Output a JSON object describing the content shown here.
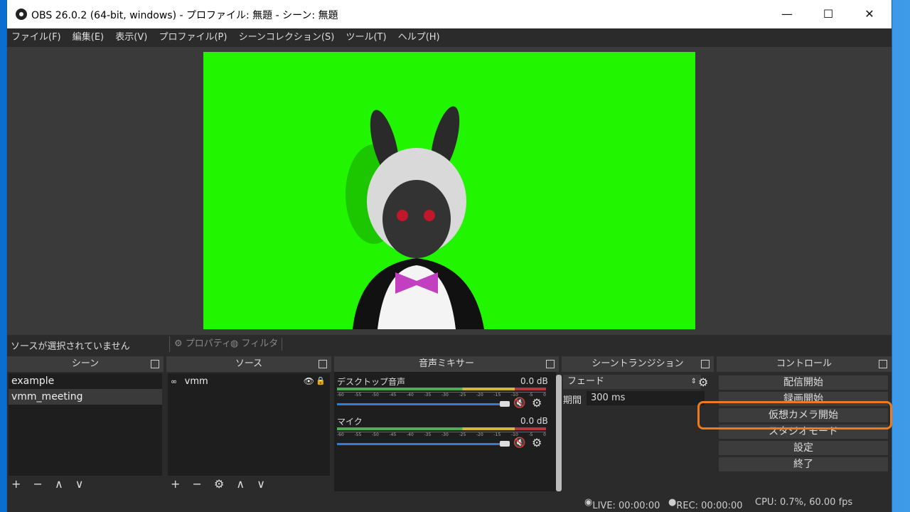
{
  "window": {
    "title": "OBS 26.0.2 (64-bit, windows) - プロファイル: 無題 - シーン: 無題",
    "minimize": "—",
    "maximize": "☐",
    "close": "✕"
  },
  "menu": [
    "ファイル(F)",
    "編集(E)",
    "表示(V)",
    "プロファイル(P)",
    "シーンコレクション(S)",
    "ツール(T)",
    "ヘルプ(H)"
  ],
  "source_bar": {
    "no_selection": "ソースが選択されていません",
    "properties": "プロパティ",
    "filters": "フィルタ"
  },
  "scenes": {
    "title": "シーン",
    "items": [
      "example",
      "vmm_meeting"
    ],
    "selected": 1,
    "tools": "+ − ∧ ∨"
  },
  "sources": {
    "title": "ソース",
    "items": [
      {
        "name": "vmm"
      }
    ],
    "tools": "+ − ⚙ ∧ ∨"
  },
  "mixer": {
    "title": "音声ミキサー",
    "channels": [
      {
        "name": "デスクトップ音声",
        "db": "0.0 dB"
      },
      {
        "name": "マイク",
        "db": "0.0 dB"
      }
    ],
    "ticks": [
      "-60",
      "-55",
      "-50",
      "-45",
      "-40",
      "-35",
      "-30",
      "-25",
      "-20",
      "-15",
      "-10",
      "-5",
      "0"
    ]
  },
  "transitions": {
    "title": "シーントランジション",
    "type": "フェード",
    "duration_label": "期間",
    "duration_value": "300 ms"
  },
  "controls": {
    "title": "コントロール",
    "buttons": [
      "配信開始",
      "録画開始",
      "仮想カメラ開始",
      "スタジオモード",
      "設定",
      "終了"
    ]
  },
  "status": {
    "live": "LIVE: 00:00:00",
    "rec": "REC: 00:00:00",
    "cpu": "CPU: 0.7%, 60.00 fps"
  },
  "colors": {
    "chroma": "#21f600",
    "highlight": "#ee7a1e"
  },
  "icons": {
    "gear": "gear-icon",
    "eye": "eye-icon",
    "lock": "lock-icon",
    "mute": "mute-icon",
    "link": "link-icon"
  }
}
